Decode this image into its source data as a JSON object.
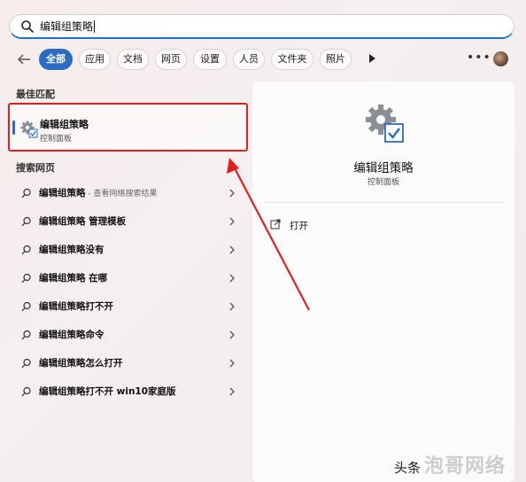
{
  "search": {
    "query": "编辑组策略"
  },
  "filters": {
    "chips": [
      "全部",
      "应用",
      "文档",
      "网页",
      "设置",
      "人员",
      "文件夹",
      "照片"
    ],
    "active_index": 0
  },
  "best_match": {
    "section_title": "最佳匹配",
    "title": "编辑组策略",
    "subtitle": "控制面板",
    "icon": "group-policy-settings-icon"
  },
  "web_search": {
    "section_title": "搜索网页",
    "items": [
      {
        "bold": "编辑组策略",
        "suffix": " - 查看网络搜索结果"
      },
      {
        "bold": "编辑组策略 管理模板",
        "suffix": ""
      },
      {
        "bold": "编辑组策略没有",
        "suffix": ""
      },
      {
        "bold": "编辑组策略 在哪",
        "suffix": ""
      },
      {
        "bold": "编辑组策略打不开",
        "suffix": ""
      },
      {
        "bold": "编辑组策略命令",
        "suffix": ""
      },
      {
        "bold": "编辑组策略怎么打开",
        "suffix": ""
      },
      {
        "bold": "编辑组策略打不开 win10家庭版",
        "suffix": ""
      }
    ]
  },
  "details": {
    "title": "编辑组策略",
    "subtitle": "控制面板",
    "actions": [
      {
        "label": "打开",
        "icon": "open-external-icon"
      }
    ]
  },
  "watermark": {
    "source": "头条",
    "brand": "泡哥网络"
  },
  "colors": {
    "accent": "#2c6bc4",
    "highlight": "#e02020"
  }
}
